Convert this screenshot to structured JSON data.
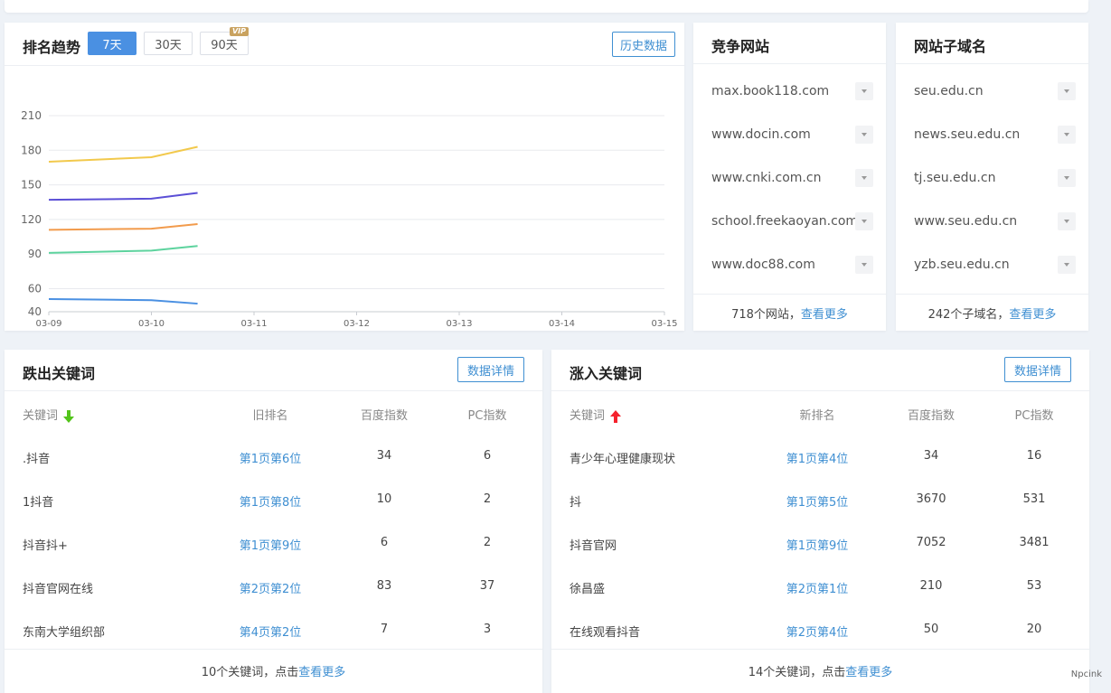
{
  "trend": {
    "title": "排名趋势",
    "ranges": [
      {
        "label": "7天",
        "active": true,
        "vip": false
      },
      {
        "label": "30天",
        "active": false,
        "vip": false
      },
      {
        "label": "90天",
        "active": false,
        "vip": true
      }
    ],
    "vip_badge": "VIP",
    "history_button": "历史数据"
  },
  "chart_data": {
    "type": "line",
    "x": [
      "03-09",
      "03-10",
      "03-11",
      "03-12",
      "03-13",
      "03-14",
      "03-15"
    ],
    "yticks": [
      40,
      60,
      90,
      120,
      150,
      180,
      210
    ],
    "ylim": [
      40,
      210
    ],
    "grid": true,
    "series": [
      {
        "color": "#f2c94c",
        "values": [
          170,
          174,
          183
        ]
      },
      {
        "color": "#5b4fd6",
        "values": [
          137,
          138,
          143
        ]
      },
      {
        "color": "#f29b4c",
        "values": [
          111,
          112,
          116
        ]
      },
      {
        "color": "#5dd39e",
        "values": [
          91,
          93,
          97
        ]
      },
      {
        "color": "#4a90e2",
        "values": [
          51,
          50,
          47
        ]
      }
    ],
    "x_points": [
      0,
      1,
      1.45
    ]
  },
  "competitors": {
    "title": "竞争网站",
    "items": [
      "max.book118.com",
      "www.docin.com",
      "www.cnki.com.cn",
      "school.freekaoyan.com",
      "www.doc88.com"
    ],
    "footer_text": "718个网站，",
    "footer_link": "查看更多"
  },
  "subdomains": {
    "title": "网站子域名",
    "items": [
      "seu.edu.cn",
      "news.seu.edu.cn",
      "tj.seu.edu.cn",
      "www.seu.edu.cn",
      "yzb.seu.edu.cn"
    ],
    "footer_text": "242个子域名，",
    "footer_link": "查看更多"
  },
  "dropped": {
    "title": "跌出关键词",
    "detail_button": "数据详情",
    "headers": [
      "关键词",
      "旧排名",
      "百度指数",
      "PC指数"
    ],
    "rows": [
      [
        ".抖音",
        "第1页第6位",
        "34",
        "6"
      ],
      [
        "1抖音",
        "第1页第8位",
        "10",
        "2"
      ],
      [
        "抖音抖+",
        "第1页第9位",
        "6",
        "2"
      ],
      [
        "抖音官网在线",
        "第2页第2位",
        "83",
        "37"
      ],
      [
        "东南大学组织部",
        "第4页第2位",
        "7",
        "3"
      ]
    ],
    "footer_text": "10个关键词，点击",
    "footer_link": "查看更多"
  },
  "rising": {
    "title": "涨入关键词",
    "detail_button": "数据详情",
    "headers": [
      "关键词",
      "新排名",
      "百度指数",
      "PC指数"
    ],
    "rows": [
      [
        "青少年心理健康现状",
        "第1页第4位",
        "34",
        "16"
      ],
      [
        "抖",
        "第1页第5位",
        "3670",
        "531"
      ],
      [
        "抖音官网",
        "第1页第9位",
        "7052",
        "3481"
      ],
      [
        "徐昌盛",
        "第2页第1位",
        "210",
        "53"
      ],
      [
        "在线观看抖音",
        "第2页第4位",
        "50",
        "20"
      ]
    ],
    "footer_text": "14个关键词，点击",
    "footer_link": "查看更多"
  },
  "watermark": "Npcink"
}
